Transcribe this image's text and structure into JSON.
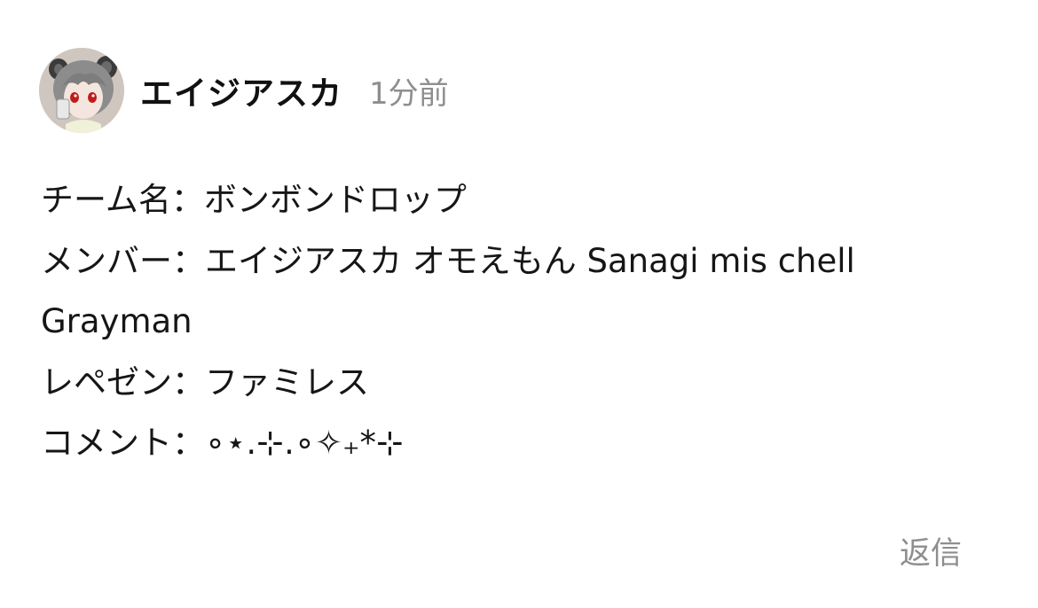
{
  "comment": {
    "author": "エイジアスカ",
    "time": "1分前",
    "avatar_icon": "anime-character-avatar",
    "lines": [
      "チーム名：ボンボンドロップ",
      "メンバー：エイジアスカ オモえもん Sanagi mis chell",
      "Grayman",
      "レペゼン：ファミレス",
      "コメント：∘⋆.⊹.∘✧₊*⊹"
    ],
    "reply_label": "返信"
  }
}
